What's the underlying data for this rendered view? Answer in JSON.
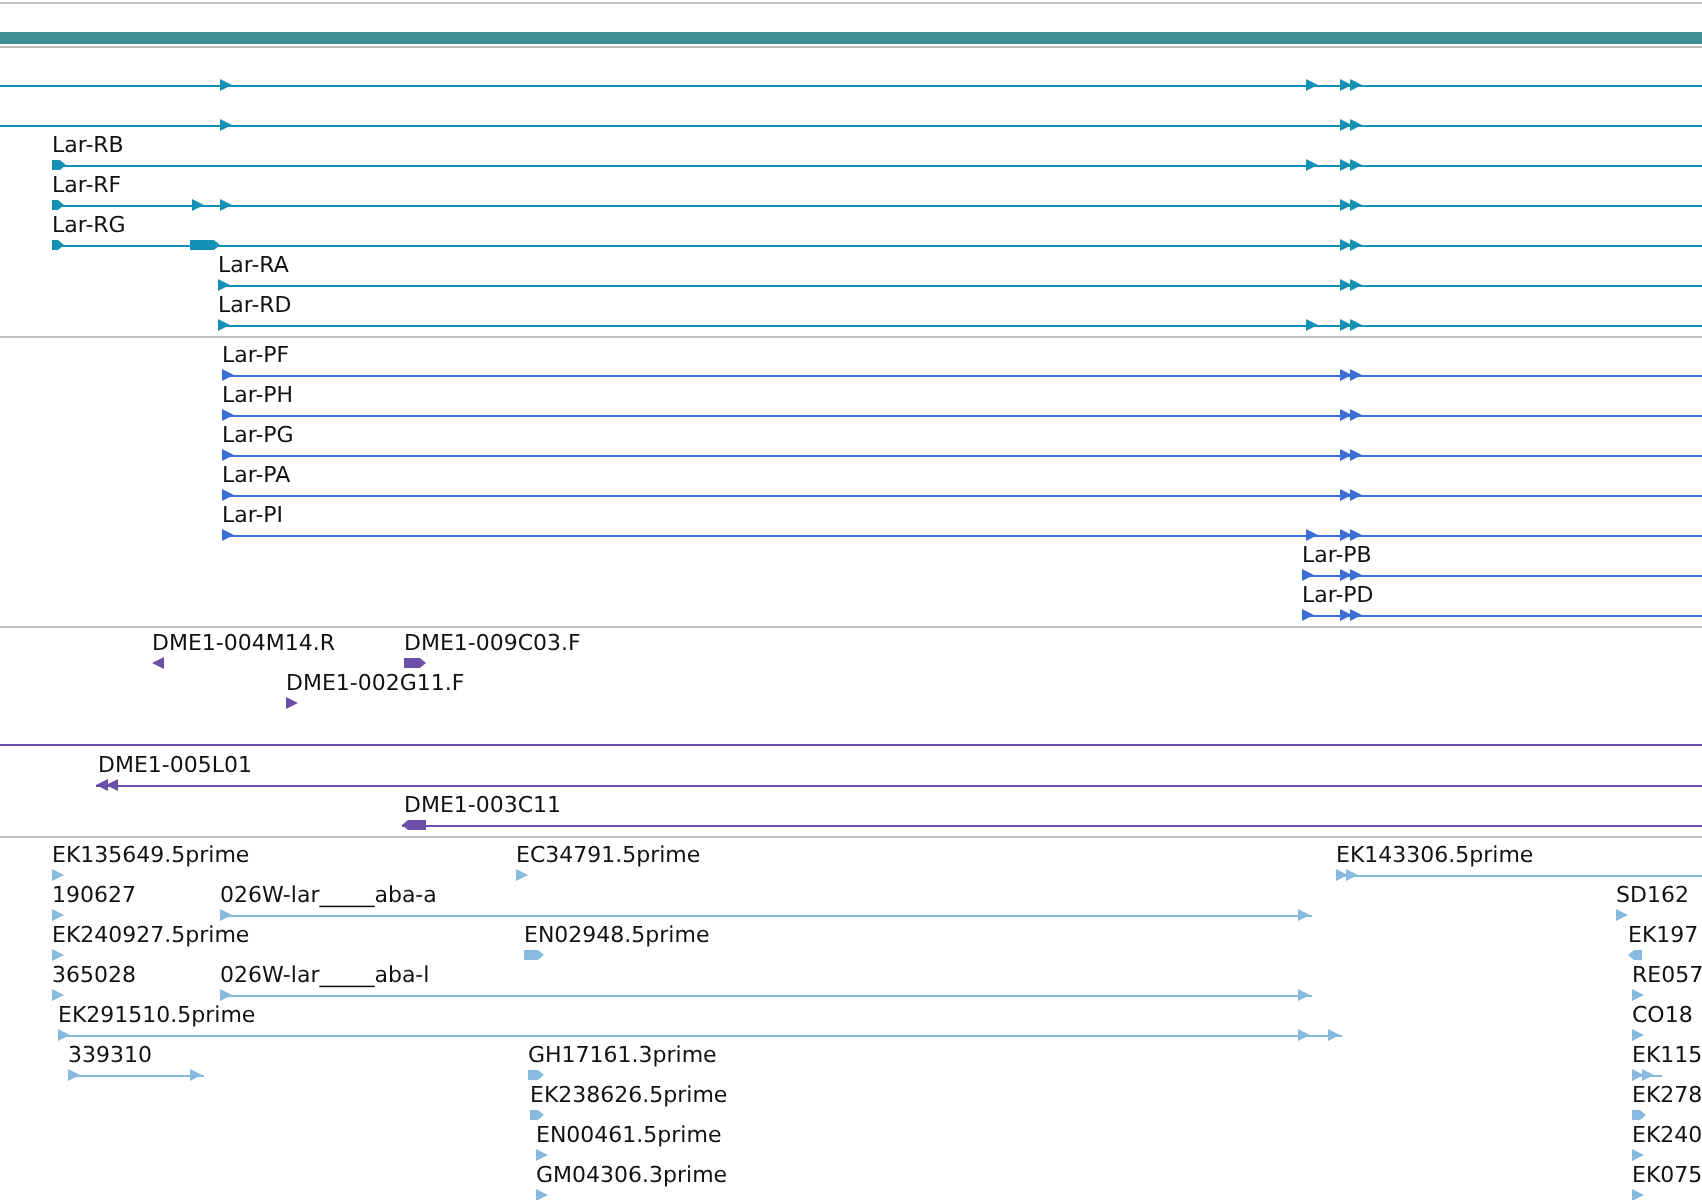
{
  "tracks": [
    {
      "color": "#1591b5",
      "features": [
        {
          "reverse": false
        },
        {
          "reverse": false
        },
        {
          "label": "Lar-RB",
          "reverse": false
        },
        {
          "label": "Lar-RF",
          "reverse": false
        },
        {
          "label": "Lar-RG",
          "reverse": false
        },
        {
          "label": "Lar-RA",
          "reverse": false
        },
        {
          "label": "Lar-RD",
          "reverse": false
        }
      ]
    },
    {
      "color": "#3b6fd6",
      "features": [
        {
          "label": "Lar-PF",
          "reverse": false
        },
        {
          "label": "Lar-PH",
          "reverse": false
        },
        {
          "label": "Lar-PG",
          "reverse": false
        },
        {
          "label": "Lar-PA",
          "reverse": false
        },
        {
          "label": "Lar-PI",
          "reverse": false
        },
        {
          "label": "Lar-PB",
          "reverse": false
        },
        {
          "label": "Lar-PD",
          "reverse": false
        }
      ]
    },
    {
      "color": "#6a4fa8",
      "features": [
        {
          "label": "DME1-004M14.R",
          "reverse": true
        },
        {
          "label": "DME1-009C03.F",
          "reverse": false
        },
        {
          "label": "DME1-002G11.F",
          "reverse": false
        },
        {
          "label": "DME1-005L01",
          "reverse": true
        },
        {
          "label": "DME1-003C11",
          "reverse": true
        }
      ]
    },
    {
      "color": "#88badf",
      "features": [
        {
          "label": "EK135649.5prime",
          "reverse": false
        },
        {
          "label": "EC34791.5prime",
          "reverse": false
        },
        {
          "label": "EK143306.5prime",
          "reverse": false
        },
        {
          "label": "190627",
          "reverse": false
        },
        {
          "label": "026W-lar_____aba-a",
          "reverse": false
        },
        {
          "label": "SD162",
          "reverse": false
        },
        {
          "label": "EK240927.5prime",
          "reverse": false
        },
        {
          "label": "EN02948.5prime",
          "reverse": false
        },
        {
          "label": "EK197",
          "reverse": true
        },
        {
          "label": "365028",
          "reverse": false
        },
        {
          "label": "026W-lar_____aba-l",
          "reverse": false
        },
        {
          "label": "RE057",
          "reverse": false
        },
        {
          "label": "EK291510.5prime",
          "reverse": false
        },
        {
          "label": "CO18",
          "reverse": false
        },
        {
          "label": "339310",
          "reverse": false
        },
        {
          "label": "GH17161.3prime",
          "reverse": false
        },
        {
          "label": "EK115",
          "reverse": false
        },
        {
          "label": "EK238626.5prime",
          "reverse": false
        },
        {
          "label": "EK278",
          "reverse": false
        },
        {
          "label": "EN00461.5prime",
          "reverse": false
        },
        {
          "label": "EK240",
          "reverse": false
        },
        {
          "label": "GM04306.3prime",
          "reverse": false
        },
        {
          "label": "EK075",
          "reverse": false
        }
      ]
    }
  ]
}
